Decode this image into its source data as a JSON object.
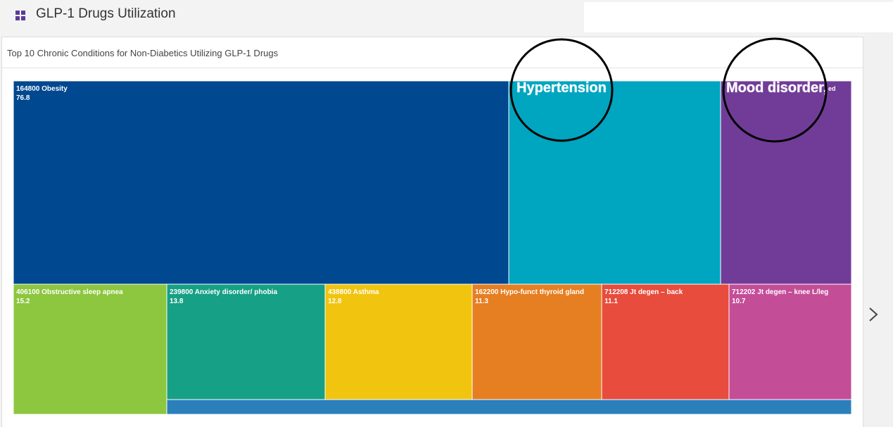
{
  "header": {
    "title": "GLP-1 Drugs Utilization",
    "icon": "grid-icon"
  },
  "panel": {
    "title": "Top 10 Chronic Conditions for Non-Diabetics Utilizing GLP-1 Drugs"
  },
  "annotations": {
    "callout_1": "Hypertension",
    "callout_2": "Mood disorder,",
    "callout_2_trailing": "ed"
  },
  "navigation": {
    "next_icon": "chevron-right-icon"
  },
  "chart_data": {
    "type": "treemap",
    "title": "Top 10 Chronic Conditions for Non-Diabetics Utilizing GLP-1 Drugs",
    "nodes": [
      {
        "code": "164800",
        "name": "Obesity",
        "value": 76.8,
        "label_line1": "164800 Obesity",
        "label_line2": "76.8",
        "color": "#00488f"
      },
      {
        "code": "",
        "name": "",
        "value": 32.7,
        "label_line1": "",
        "label_line2": "",
        "color": "#00a5bf"
      },
      {
        "code": "",
        "name": "",
        "value": 20.3,
        "label_line1": "",
        "label_line2": "",
        "color": "#713c97"
      },
      {
        "code": "406100",
        "name": "Obstructive sleep apnea",
        "value": 15.2,
        "label_line1": "406100 Obstructive sleep apnea",
        "label_line2": "15.2",
        "color": "#8dc63f"
      },
      {
        "code": "239800",
        "name": "Anxiety disorder/ phobia",
        "value": 13.8,
        "label_line1": "239800 Anxiety disorder/ phobia",
        "label_line2": "13.8",
        "color": "#16a085"
      },
      {
        "code": "438800",
        "name": "Asthma",
        "value": 12.8,
        "label_line1": "438800 Asthma",
        "label_line2": "12.8",
        "color": "#f1c40f"
      },
      {
        "code": "162200",
        "name": "Hypo-funct thyroid gland",
        "value": 11.3,
        "label_line1": "162200 Hypo-funct thyroid gland",
        "label_line2": "11.3",
        "color": "#e67e22"
      },
      {
        "code": "712208",
        "name": "Jt degen – back",
        "value": 11.1,
        "label_line1": "712208 Jt degen – back",
        "label_line2": "11.1",
        "color": "#e74c3c"
      },
      {
        "code": "712202",
        "name": "Jt degen – knee L/leg",
        "value": 10.7,
        "label_line1": "712202 Jt degen – knee L/leg",
        "label_line2": "10.7",
        "color": "#c44d98"
      },
      {
        "code": "",
        "name": "",
        "value": 3.4,
        "label_line1": "",
        "label_line2": "",
        "color": "#2b7fbb"
      }
    ]
  }
}
